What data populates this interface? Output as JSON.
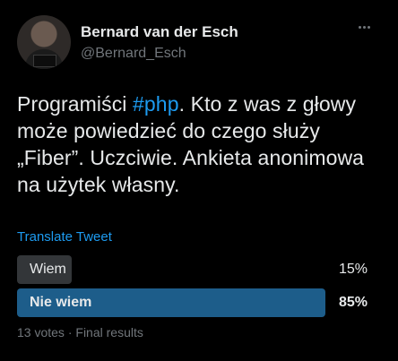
{
  "author": {
    "display_name": "Bernard van der Esch",
    "handle": "@Bernard_Esch",
    "avatar_icon": "profile-photo"
  },
  "tweet": {
    "text_before": "Programiści ",
    "hashtag": "#php",
    "text_after": ". Kto z was z głowy może powiedzieć do czego służy „Fiber”. Uczciwie. Ankieta anonimowa na użytek własny.",
    "translate_label": "Translate Tweet"
  },
  "poll": {
    "options": [
      {
        "label": "Wiem",
        "percent_label": "15%",
        "fraction": 0.15,
        "winner": false
      },
      {
        "label": "Nie wiem",
        "percent_label": "85%",
        "fraction": 0.85,
        "winner": true
      }
    ],
    "votes": "13 votes",
    "separator": "·",
    "status": "Final results"
  },
  "colors": {
    "background": "#000000",
    "text": "#e7e9ea",
    "muted": "#71767b",
    "link": "#1d9bf0",
    "poll_winner": "#1d5d8a",
    "poll_other": "#333639"
  }
}
